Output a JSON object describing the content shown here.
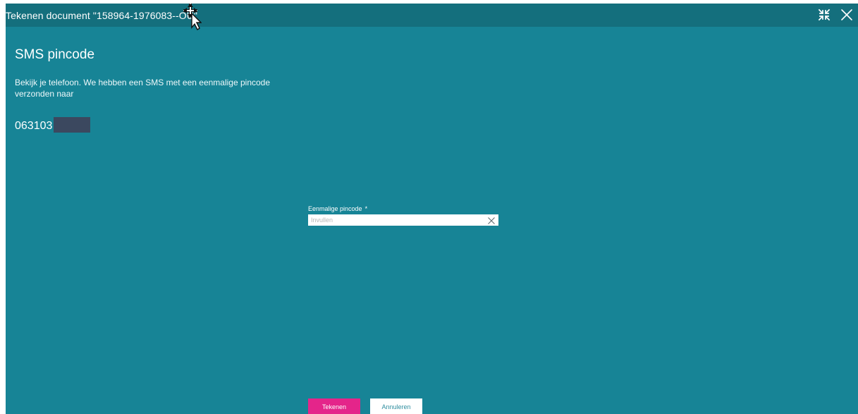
{
  "window": {
    "title": "Tekenen document \"158964-1976083‑‑OU\"",
    "actions": [
      {
        "name": "minimize-arrows-icon"
      },
      {
        "name": "close-icon"
      }
    ]
  },
  "main": {
    "heading": "SMS pincode",
    "message": "Bekijk je telefoon. We hebben een SMS met een eenmalige pincode verzonden naar",
    "phone_prefix": "063103"
  },
  "form": {
    "label": "Eenmalige pincode",
    "required_marker": "*",
    "placeholder": "Invullen",
    "value": ""
  },
  "buttons": {
    "submit": "Tekenen",
    "cancel": "Annuleren"
  },
  "colors": {
    "background": "#178496",
    "titlebar": "#146f7d",
    "primary_button": "#e4258a",
    "mask": "#3b485f"
  }
}
